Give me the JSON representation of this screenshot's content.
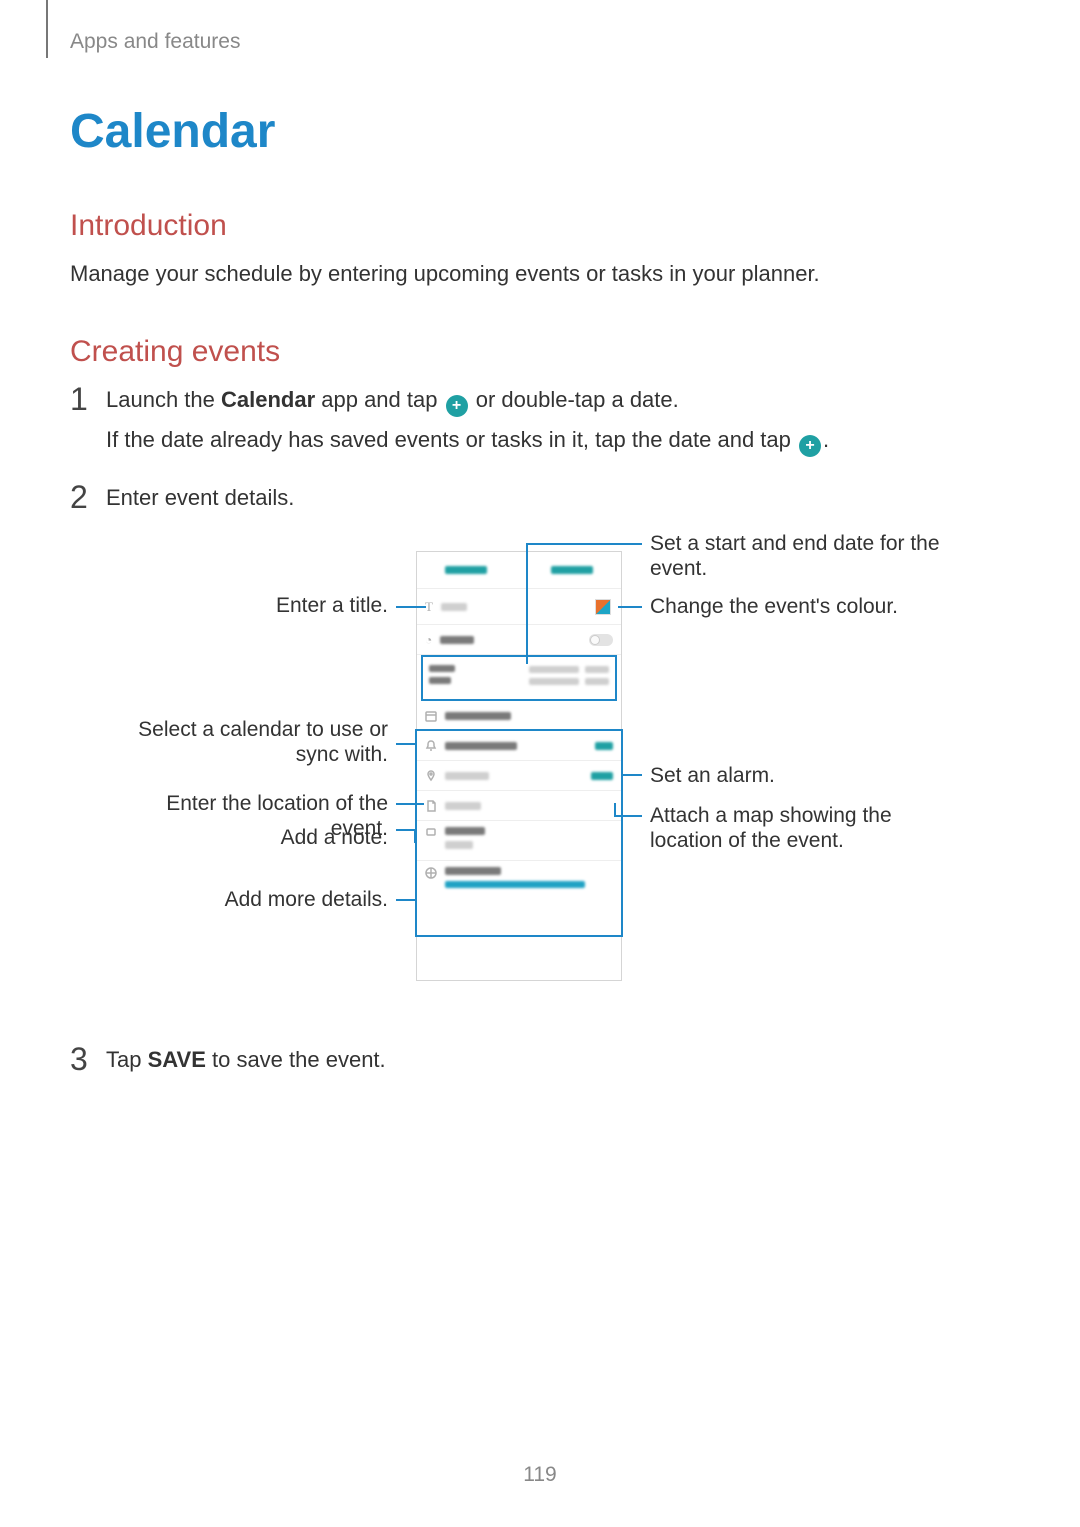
{
  "breadcrumb": "Apps and features",
  "title": "Calendar",
  "sections": {
    "intro_heading": "Introduction",
    "intro_text": "Manage your schedule by entering upcoming events or tasks in your planner.",
    "create_heading": "Creating events"
  },
  "steps": {
    "s1": {
      "num": "1",
      "line1_a": "Launch the ",
      "line1_b": "Calendar",
      "line1_c": " app and tap ",
      "line1_d": " or double-tap a date.",
      "line2_a": "If the date already has saved events or tasks in it, tap the date and tap ",
      "line2_b": "."
    },
    "s2": {
      "num": "2",
      "text": "Enter event details."
    },
    "s3": {
      "num": "3",
      "text_a": "Tap ",
      "text_b": "SAVE",
      "text_c": " to save the event."
    }
  },
  "callouts": {
    "title_label": "Enter a title.",
    "calendar_label": "Select a calendar to use or sync with.",
    "location_label": "Enter the location of the event.",
    "note_label": "Add a note.",
    "details_label": "Add more details.",
    "dates_label": "Set a start and end date for the event.",
    "colour_label": "Change the event's colour.",
    "alarm_label": "Set an alarm.",
    "map_label": "Attach a map showing the location of the event."
  },
  "page_number": "119"
}
